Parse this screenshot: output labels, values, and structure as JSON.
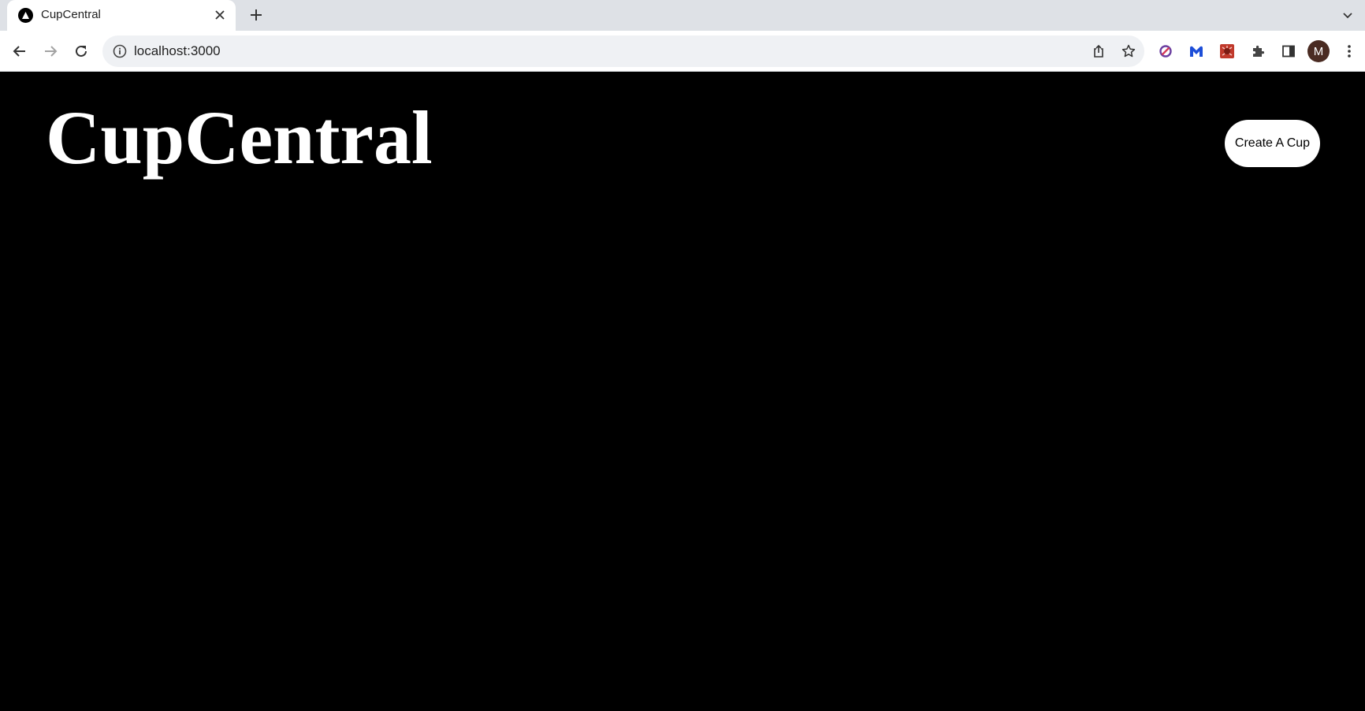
{
  "browser": {
    "tab": {
      "title": "CupCentral"
    },
    "address_bar": {
      "url": "localhost:3000"
    },
    "profile_initial": "M"
  },
  "page": {
    "site_title": "CupCentral",
    "create_button_label": "Create A Cup"
  }
}
